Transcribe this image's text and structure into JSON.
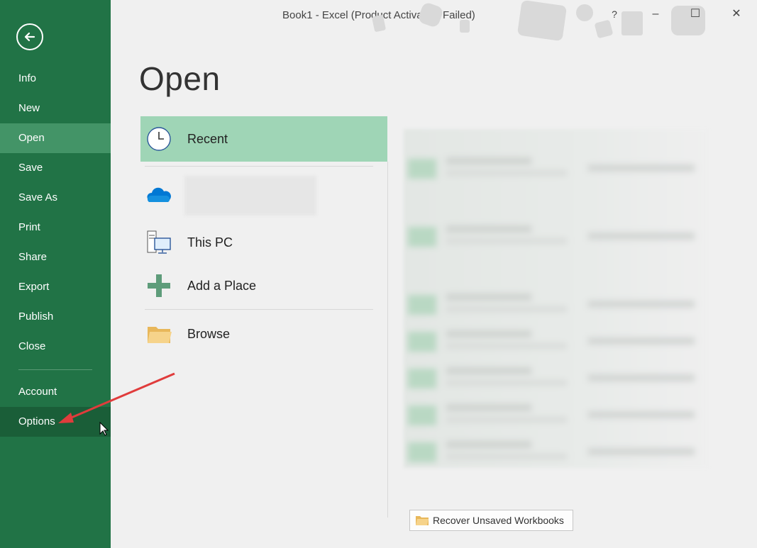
{
  "window": {
    "title": "Book1  -  Excel (Product Activation Failed)",
    "controls": {
      "help": "?",
      "minimize": "–",
      "maximize": "☐",
      "close": "✕"
    }
  },
  "sidebar": {
    "back_icon": "back-arrow-icon",
    "items": [
      {
        "label": "Info"
      },
      {
        "label": "New"
      },
      {
        "label": "Open"
      },
      {
        "label": "Save"
      },
      {
        "label": "Save As"
      },
      {
        "label": "Print"
      },
      {
        "label": "Share"
      },
      {
        "label": "Export"
      },
      {
        "label": "Publish"
      },
      {
        "label": "Close"
      },
      {
        "label": "Account"
      },
      {
        "label": "Options"
      }
    ],
    "active_item": "Open",
    "highlighted_item": "Options"
  },
  "main": {
    "title": "Open",
    "locations": [
      {
        "label": "Recent",
        "icon": "clock-icon",
        "active": true
      },
      {
        "label": "",
        "icon": "onedrive-cloud-icon"
      },
      {
        "label": "This PC",
        "icon": "computer-icon"
      },
      {
        "label": "Add a Place",
        "icon": "plus-icon"
      },
      {
        "label": "Browse",
        "icon": "folder-icon"
      }
    ],
    "recover_button": "Recover Unsaved Workbooks"
  },
  "colors": {
    "sidebar_bg": "#217346",
    "sidebar_active": "#439467",
    "location_active": "#9fd5b6",
    "annotation_arrow": "#e03c3c"
  }
}
